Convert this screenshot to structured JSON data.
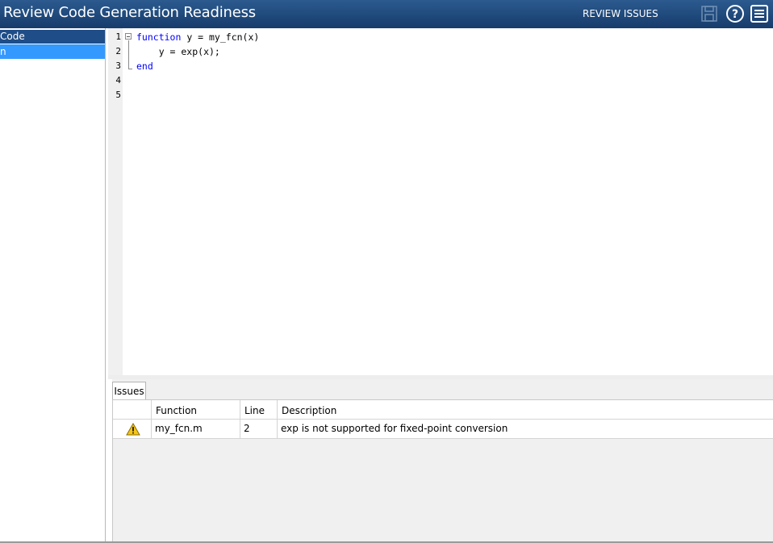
{
  "window": {
    "title": "Review Code Generation Readiness",
    "mode_label": "REVIEW ISSUES",
    "icons": {
      "save": "save-icon",
      "help": "help-icon",
      "menu": "menu-icon"
    }
  },
  "sidebar": {
    "header": "Code",
    "items": [
      {
        "label": "n"
      }
    ]
  },
  "editor": {
    "lines": [
      {
        "no": "1",
        "keyword": "function",
        "text": " y = my_fcn(x)"
      },
      {
        "no": "2",
        "keyword": "",
        "text": "    y = exp(x);"
      },
      {
        "no": "3",
        "keyword": "end",
        "text": ""
      },
      {
        "no": "4",
        "keyword": "",
        "text": ""
      },
      {
        "no": "5",
        "keyword": "",
        "text": ""
      }
    ]
  },
  "issues": {
    "tab_label": "Issues",
    "columns": [
      "Function",
      "Line",
      "Description"
    ],
    "rows": [
      {
        "icon": "warning-icon",
        "function": "my_fcn.m",
        "line": "2",
        "description": "exp is not supported for fixed-point conversion"
      }
    ]
  },
  "colors": {
    "titlebar": "#1f4d87",
    "selection": "#3399ff",
    "keyword": "#0000ff",
    "warning": "#f5c518"
  }
}
